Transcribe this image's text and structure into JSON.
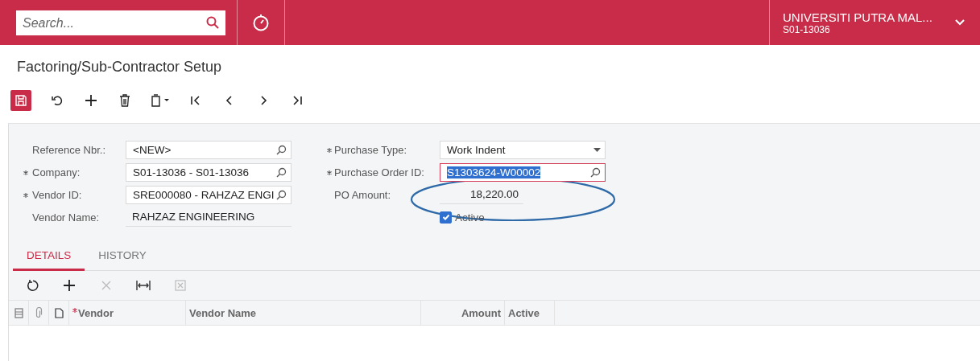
{
  "header": {
    "search": {
      "placeholder": "Search..."
    },
    "company": {
      "name": "UNIVERSITI PUTRA MAL...",
      "code": "S01-13036"
    }
  },
  "page_title": "Factoring/Sub-Contractor Setup",
  "form": {
    "left": [
      {
        "kind": "lookup",
        "label": "Reference Nbr.:",
        "required": false,
        "value": "<NEW>",
        "focused": false
      },
      {
        "kind": "lookup",
        "label": "Company:",
        "required": true,
        "value": "S01-13036 - S01-13036",
        "focused": false
      },
      {
        "kind": "lookup",
        "label": "Vendor ID:",
        "required": true,
        "value": "SRE000080 - RAHZAZ ENGI",
        "focused": false
      },
      {
        "kind": "text",
        "label": "Vendor Name:",
        "required": false,
        "value": "RAHZAZ ENGINEERING"
      }
    ],
    "right": [
      {
        "kind": "select",
        "label": "Purchase Type:",
        "required": true,
        "value": "Work Indent",
        "focused": false
      },
      {
        "kind": "lookup",
        "label": "Purchase Order ID:",
        "required": true,
        "value": "S1303624-W00002",
        "focused": true
      },
      {
        "kind": "number",
        "label": "PO Amount:",
        "required": false,
        "value": "18,220.00"
      },
      {
        "kind": "checkbox",
        "label": "Active",
        "checked": true
      }
    ]
  },
  "tabs": [
    {
      "label": "DETAILS",
      "selected": true
    },
    {
      "label": "HISTORY",
      "selected": false
    }
  ],
  "grid": {
    "columns": [
      {
        "label": "Vendor",
        "required": true
      },
      {
        "label": "Vendor Name",
        "required": false
      },
      {
        "label": "Amount",
        "required": false
      },
      {
        "label": "Active",
        "required": false
      }
    ]
  }
}
